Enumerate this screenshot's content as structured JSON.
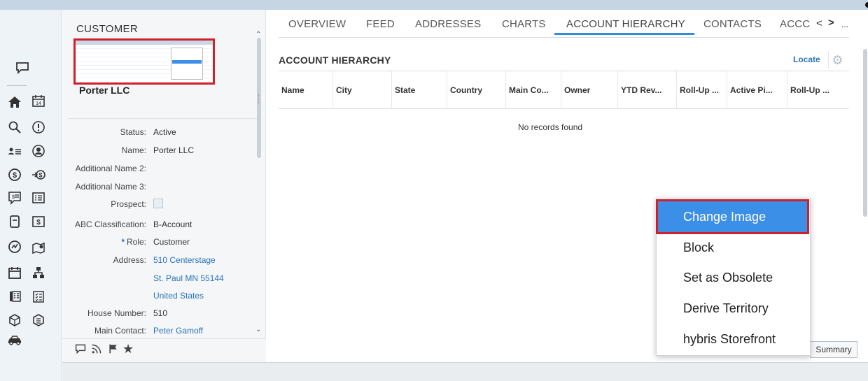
{
  "customer": {
    "title": "CUSTOMER",
    "company": "Porter LLC",
    "fields": {
      "status_label": "Status:",
      "status_value": "Active",
      "name_label": "Name:",
      "name_value": "Porter LLC",
      "add2_label": "Additional Name 2:",
      "add3_label": "Additional Name 3:",
      "prospect_label": "Prospect:",
      "abc_label": "ABC Classification:",
      "abc_value": "B-Account",
      "role_req": "*",
      "role_label": "Role:",
      "role_value": "Customer",
      "address_label": "Address:",
      "address_line1": "510 Centerstage",
      "address_line2": "St. Paul MN 55144",
      "address_line3": "United States",
      "house_label": "House Number:",
      "house_value": "510",
      "contact_label": "Main Contact:",
      "contact_value": "Peter Gamoff"
    }
  },
  "tabs": {
    "overview": "OVERVIEW",
    "feed": "FEED",
    "addresses": "ADDRESSES",
    "charts": "CHARTS",
    "account_hierarchy": "ACCOUNT HIERARCHY",
    "contacts": "CONTACTS",
    "acc": "ACCC",
    "prev": "<",
    "next": ">",
    "more": "..."
  },
  "section": {
    "title": "ACCOUNT HIERARCHY",
    "locate": "Locate",
    "empty": "No records found"
  },
  "table": {
    "columns": [
      "Name",
      "City",
      "State",
      "Country",
      "Main Co...",
      "Owner",
      "YTD Rev...",
      "Roll-Up ...",
      "Active Pi...",
      "Roll-Up ..."
    ]
  },
  "context_menu": {
    "items": [
      "Change Image",
      "Block",
      "Set as Obsolete",
      "Derive Territory",
      "hybris Storefront"
    ],
    "selected": "Change Image"
  },
  "footer": {
    "summary": "Summary"
  },
  "icons": {
    "rail": [
      "chat-icon",
      "home-icon",
      "calendar-icon",
      "search-icon",
      "alert-icon",
      "people-list-icon",
      "user-icon",
      "money-icon",
      "money-arrow-icon",
      "quote-icon",
      "list-icon",
      "document-icon",
      "invoice-icon",
      "activity-icon",
      "map-icon",
      "calendar2-icon",
      "hierarchy-icon",
      "phone-book-icon",
      "checklist-icon",
      "cube-icon",
      "box-icon",
      "car-icon"
    ]
  },
  "colors": {
    "accent": "#2f8be0",
    "highlight_border": "#d0202a",
    "selected_item": "#3c8fe6",
    "link": "#2a73b7"
  }
}
